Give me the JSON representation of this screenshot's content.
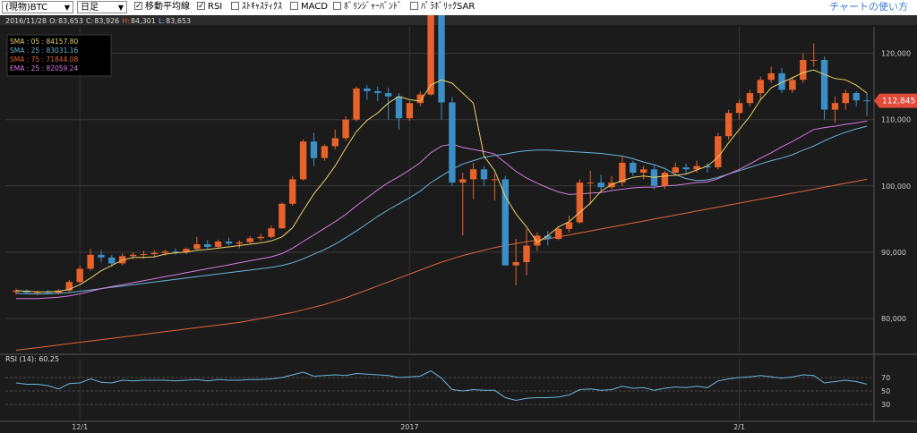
{
  "toolbar": {
    "symbol": "(現物)BTC",
    "period": "日足",
    "checks": [
      {
        "label": "移動平均線",
        "checked": true
      },
      {
        "label": "RSI",
        "checked": true
      },
      {
        "label": "ｽﾄｷｬｽﾃｨｸｽ",
        "checked": false
      },
      {
        "label": "MACD",
        "checked": false
      },
      {
        "label": "ﾎﾞﾘﾝｼﾞｬｰﾊﾞﾝﾄﾞ",
        "checked": false
      },
      {
        "label": "ﾊﾟﾗﾎﾞﾘｯｸSAR",
        "checked": false
      }
    ],
    "help_link": "チャートの使い方"
  },
  "chart_data": {
    "type": "candlestick",
    "ohlc_label": {
      "date": "2016/11/28",
      "o_key": "O:",
      "o": "83,653",
      "c_key": "C:",
      "c": "83,926",
      "h_key": "H:",
      "h": "84,301",
      "l_key": "L:",
      "l": "83,653"
    },
    "legend": [
      {
        "name": "SMA : 05 : 84157.80",
        "color": "#e8d16a"
      },
      {
        "name": "SMA : 25 : 83031.16",
        "color": "#6ab6d8"
      },
      {
        "name": "SMA : 75 : 71844.08",
        "color": "#e0643c"
      },
      {
        "name": "EMA : 25 : 82059.24",
        "color": "#d67be0"
      }
    ],
    "last_price_label": "112,845",
    "ylim": [
      75000,
      124000
    ],
    "yticks": [
      {
        "v": 80000,
        "label": "80,000"
      },
      {
        "v": 90000,
        "label": "90,000"
      },
      {
        "v": 100000,
        "label": "100,000"
      },
      {
        "v": 110000,
        "label": "110,000"
      },
      {
        "v": 120000,
        "label": "120,000"
      }
    ],
    "xticks": [
      {
        "i": 6,
        "label": "12/1"
      },
      {
        "i": 37,
        "label": "2017"
      },
      {
        "i": 68,
        "label": "2/1"
      }
    ],
    "candles": [
      [
        84000,
        84500,
        83600,
        84200
      ],
      [
        84200,
        84400,
        83700,
        83900
      ],
      [
        83900,
        84200,
        83500,
        84000
      ],
      [
        84000,
        84300,
        83700,
        83900
      ],
      [
        83900,
        84400,
        83600,
        84200
      ],
      [
        84200,
        85800,
        84000,
        85500
      ],
      [
        85500,
        88000,
        85300,
        87500
      ],
      [
        87500,
        90500,
        87200,
        89600
      ],
      [
        89600,
        90300,
        88500,
        89200
      ],
      [
        89200,
        89600,
        87800,
        88300
      ],
      [
        88300,
        89800,
        88000,
        89400
      ],
      [
        89400,
        90000,
        88900,
        89600
      ],
      [
        89600,
        90200,
        89000,
        89700
      ],
      [
        89700,
        90300,
        89200,
        89900
      ],
      [
        89900,
        90400,
        89500,
        90100
      ],
      [
        90100,
        90600,
        89600,
        90000
      ],
      [
        90000,
        90700,
        89700,
        90500
      ],
      [
        90500,
        92300,
        90300,
        91200
      ],
      [
        91200,
        91800,
        90500,
        90800
      ],
      [
        90800,
        91900,
        90500,
        91600
      ],
      [
        91600,
        92200,
        91000,
        91300
      ],
      [
        91300,
        91800,
        90600,
        91500
      ],
      [
        91500,
        92400,
        91300,
        92100
      ],
      [
        92100,
        92800,
        91700,
        92300
      ],
      [
        92300,
        94000,
        92100,
        93600
      ],
      [
        93600,
        97500,
        93500,
        97300
      ],
      [
        97300,
        101500,
        97000,
        101000
      ],
      [
        101000,
        107000,
        100800,
        106700
      ],
      [
        106700,
        108000,
        103000,
        104200
      ],
      [
        104200,
        106300,
        103800,
        106000
      ],
      [
        106000,
        108500,
        105500,
        107200
      ],
      [
        107200,
        110500,
        106800,
        110000
      ],
      [
        110000,
        115000,
        109700,
        114700
      ],
      [
        114700,
        115200,
        113000,
        114300
      ],
      [
        114300,
        115000,
        112800,
        114000
      ],
      [
        114000,
        114800,
        110000,
        113500
      ],
      [
        113500,
        114000,
        108500,
        110200
      ],
      [
        110200,
        112800,
        109800,
        112500
      ],
      [
        112500,
        114300,
        112000,
        113800
      ],
      [
        113800,
        129000,
        113600,
        128000
      ],
      [
        128000,
        129000,
        110000,
        112600
      ],
      [
        112600,
        113400,
        100000,
        100500
      ],
      [
        100500,
        102000,
        92500,
        101000
      ],
      [
        101000,
        103500,
        98000,
        102500
      ],
      [
        102500,
        103000,
        100000,
        101000
      ],
      [
        101000,
        101800,
        97800,
        101000
      ],
      [
        101000,
        101500,
        88000,
        88000
      ],
      [
        88000,
        92000,
        85000,
        88500
      ],
      [
        88500,
        93500,
        86500,
        91000
      ],
      [
        91000,
        93000,
        90200,
        92500
      ],
      [
        92500,
        93200,
        91000,
        92000
      ],
      [
        92000,
        93800,
        91800,
        93500
      ],
      [
        93500,
        95500,
        93000,
        94500
      ],
      [
        94500,
        101000,
        94300,
        100500
      ],
      [
        100500,
        102300,
        97200,
        100500
      ],
      [
        100500,
        101700,
        99300,
        99800
      ],
      [
        99800,
        101500,
        99500,
        100500
      ],
      [
        100500,
        104500,
        100000,
        103500
      ],
      [
        103500,
        103800,
        101500,
        102000
      ],
      [
        102000,
        103000,
        101000,
        102500
      ],
      [
        102500,
        103200,
        99500,
        100000
      ],
      [
        100000,
        102300,
        99500,
        102000
      ],
      [
        102000,
        103500,
        101500,
        102800
      ],
      [
        102800,
        103400,
        101800,
        102500
      ],
      [
        102500,
        103800,
        102000,
        103000
      ],
      [
        103000,
        103500,
        102000,
        102800
      ],
      [
        102800,
        108000,
        102500,
        107500
      ],
      [
        107500,
        111500,
        107000,
        111000
      ],
      [
        111000,
        113000,
        110000,
        112500
      ],
      [
        112500,
        114500,
        112000,
        114000
      ],
      [
        114000,
        116500,
        113000,
        116000
      ],
      [
        116000,
        118000,
        115500,
        117000
      ],
      [
        117000,
        117800,
        114000,
        114500
      ],
      [
        114500,
        116500,
        114000,
        116000
      ],
      [
        116000,
        120000,
        115500,
        119000
      ],
      [
        119000,
        121500,
        118000,
        119000
      ],
      [
        119000,
        119500,
        110000,
        111500
      ],
      [
        111500,
        113500,
        109500,
        112500
      ],
      [
        112500,
        114500,
        111500,
        114000
      ],
      [
        114000,
        114300,
        112000,
        112900
      ],
      [
        112900,
        114000,
        110500,
        112845
      ]
    ],
    "sma5": [
      84200,
      84100,
      84000,
      84000,
      84100,
      84400,
      85100,
      86100,
      87200,
      88000,
      88800,
      89200,
      89200,
      89300,
      89700,
      89900,
      90000,
      90300,
      90400,
      90600,
      90800,
      91000,
      91200,
      91400,
      91700,
      92300,
      93700,
      96300,
      98800,
      100800,
      103000,
      105700,
      108200,
      109900,
      111000,
      112500,
      113500,
      113000,
      112800,
      115200,
      116000,
      115500,
      114000,
      112500,
      104500,
      102300,
      98400,
      95800,
      93800,
      91500,
      92500,
      93800,
      94600,
      96000,
      97400,
      99200,
      100200,
      100800,
      101300,
      101500,
      101300,
      101500,
      101600,
      101800,
      102400,
      103000,
      104300,
      106500,
      108500,
      110500,
      113000,
      114800,
      115600,
      116300,
      117100,
      117500,
      116800,
      116200,
      116000,
      115200,
      114000
    ],
    "sma25": [
      83800,
      83700,
      83700,
      83700,
      83800,
      83900,
      84100,
      84300,
      84500,
      84700,
      84900,
      85100,
      85300,
      85500,
      85700,
      85900,
      86100,
      86300,
      86500,
      86700,
      86900,
      87100,
      87300,
      87500,
      87700,
      88000,
      88400,
      89000,
      89700,
      90400,
      91200,
      92200,
      93200,
      94300,
      95400,
      96400,
      97300,
      98200,
      99200,
      100500,
      101500,
      102500,
      103300,
      103800,
      104300,
      104600,
      104800,
      105100,
      105300,
      105400,
      105400,
      105300,
      105200,
      105100,
      105000,
      104900,
      104700,
      104500,
      104100,
      103600,
      103200,
      102600,
      101700,
      101100,
      100800,
      100900,
      101300,
      101800,
      102300,
      102800,
      103300,
      103800,
      104200,
      104700,
      105400,
      106000,
      106800,
      107500,
      108100,
      108600,
      109000
    ],
    "ema25": [
      83000,
      83000,
      83000,
      83100,
      83200,
      83400,
      83700,
      84100,
      84500,
      84800,
      85100,
      85400,
      85700,
      86000,
      86300,
      86600,
      86900,
      87200,
      87500,
      87800,
      88100,
      88400,
      88700,
      89000,
      89300,
      89800,
      90600,
      91600,
      92600,
      93600,
      94600,
      95700,
      97000,
      98200,
      99400,
      100500,
      101400,
      102400,
      103500,
      105000,
      106000,
      106300,
      105800,
      105500,
      105200,
      104800,
      103500,
      102200,
      101200,
      100400,
      99700,
      99100,
      98700,
      98800,
      98900,
      99000,
      99300,
      99500,
      99700,
      99800,
      99800,
      100000,
      100100,
      100300,
      100500,
      100600,
      101100,
      101800,
      102500,
      103300,
      104200,
      105000,
      105900,
      106700,
      107600,
      108500,
      108800,
      109000,
      109300,
      109500,
      109800
    ],
    "sma75": [
      75200,
      75400,
      75600,
      75800,
      76000,
      76200,
      76400,
      76600,
      76800,
      77000,
      77200,
      77400,
      77600,
      77800,
      78000,
      78200,
      78400,
      78600,
      78800,
      79000,
      79200,
      79400,
      79700,
      80000,
      80300,
      80600,
      80900,
      81300,
      81700,
      82100,
      82600,
      83100,
      83700,
      84300,
      84900,
      85500,
      86100,
      86700,
      87300,
      87900,
      88500,
      89000,
      89500,
      89900,
      90300,
      90700,
      91000,
      91300,
      91600,
      91800,
      92000,
      92300,
      92600,
      92900,
      93200,
      93500,
      93800,
      94100,
      94400,
      94700,
      95000,
      95300,
      95600,
      95900,
      96200,
      96500,
      96800,
      97100,
      97400,
      97700,
      98000,
      98300,
      98600,
      98900,
      99200,
      99500,
      99800,
      100100,
      100400,
      100700,
      101000
    ],
    "rsi": {
      "label": "RSI (14): 60.25",
      "ylim": [
        10,
        90
      ],
      "yticks": [
        {
          "v": 30,
          "label": "30"
        },
        {
          "v": 50,
          "label": "50"
        },
        {
          "v": 70,
          "label": "70"
        }
      ],
      "values": [
        62,
        60,
        60,
        58,
        53,
        61,
        62,
        68,
        63,
        62,
        66,
        65,
        66,
        66,
        66,
        65,
        66,
        67,
        65,
        67,
        66,
        66,
        67,
        67,
        68,
        70,
        74,
        78,
        72,
        73,
        74,
        73,
        76,
        75,
        74,
        73,
        70,
        71,
        72,
        80,
        69,
        52,
        50,
        52,
        51,
        51,
        40,
        36,
        39,
        40,
        40,
        41,
        44,
        52,
        53,
        51,
        52,
        57,
        54,
        55,
        51,
        54,
        56,
        55,
        57,
        55,
        65,
        68,
        70,
        71,
        73,
        71,
        69,
        71,
        74,
        73,
        62,
        64,
        66,
        64,
        60
      ]
    }
  }
}
